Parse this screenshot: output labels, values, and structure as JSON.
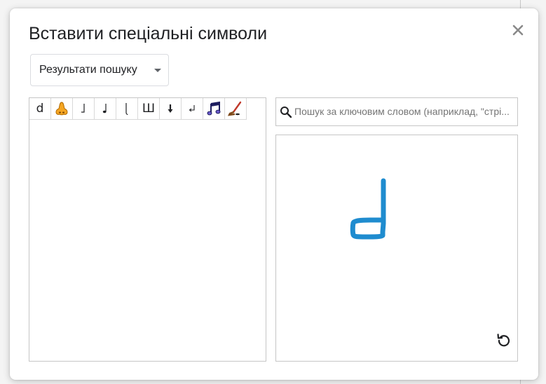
{
  "dialog": {
    "title": "Вставити спеціальні символи",
    "close_icon": "close-icon"
  },
  "category_dropdown": {
    "selected": "Результати пошуку"
  },
  "results": {
    "symbols": [
      {
        "char": "d",
        "name": "latin-small-d"
      },
      {
        "char": "",
        "icon": "nose-icon"
      },
      {
        "char": "𝅘𝅥",
        "name": "note-half-glyph"
      },
      {
        "char": "♩",
        "name": "quarter-note"
      },
      {
        "char": "𝅗",
        "name": "half-note-stem-glyph"
      },
      {
        "char": "Ш",
        "name": "cyrillic-sha"
      },
      {
        "char": "⬇",
        "name": "down-arrow"
      },
      {
        "char": "↲",
        "name": "return-arrow"
      },
      {
        "char": "",
        "icon": "music-notes-icon"
      },
      {
        "char": "",
        "icon": "hockey-stick-icon"
      }
    ]
  },
  "search": {
    "placeholder": "Пошук за ключовим словом (наприклад, \"стрі..."
  },
  "draw": {
    "stroke_color": "#1f8ccf"
  },
  "colors": {
    "text": "#202124",
    "border": "#c6c6c6",
    "accent_stroke": "#1f8ccf"
  }
}
